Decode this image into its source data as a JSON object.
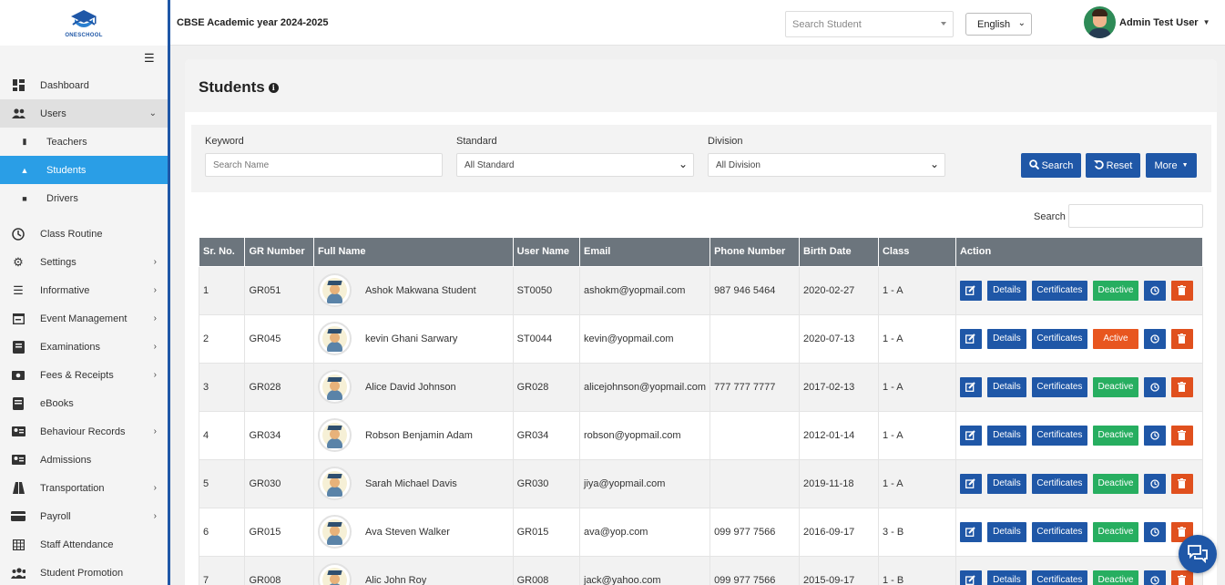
{
  "app": {
    "logo_text": "ONESCHOOL",
    "academic_year": "CBSE Academic year 2024-2025"
  },
  "topbar": {
    "search_placeholder": "Search Student",
    "language": "English",
    "user_name": "Admin Test User"
  },
  "sidebar": {
    "items": [
      {
        "label": "Dashboard",
        "icon": "dashboard-icon"
      },
      {
        "label": "Users",
        "icon": "users-icon"
      },
      {
        "label": "Teachers",
        "icon": "teacher-icon"
      },
      {
        "label": "Students",
        "icon": "graduation-cap-icon"
      },
      {
        "label": "Drivers",
        "icon": "bus-icon"
      },
      {
        "label": "Class Routine",
        "icon": "clock-icon"
      },
      {
        "label": "Settings",
        "icon": "gear-icon"
      },
      {
        "label": "Informative",
        "icon": "list-icon"
      },
      {
        "label": "Event Management",
        "icon": "calendar-icon"
      },
      {
        "label": "Examinations",
        "icon": "book-icon"
      },
      {
        "label": "Fees & Receipts",
        "icon": "money-icon"
      },
      {
        "label": "eBooks",
        "icon": "ebook-icon"
      },
      {
        "label": "Behaviour Records",
        "icon": "id-card-icon"
      },
      {
        "label": "Admissions",
        "icon": "address-card-icon"
      },
      {
        "label": "Transportation",
        "icon": "road-icon"
      },
      {
        "label": "Payroll",
        "icon": "credit-card-icon"
      },
      {
        "label": "Staff Attendance",
        "icon": "table-icon"
      },
      {
        "label": "Student Promotion",
        "icon": "group-icon"
      }
    ]
  },
  "page": {
    "title": "Students"
  },
  "filters": {
    "keyword_label": "Keyword",
    "keyword_placeholder": "Search Name",
    "standard_label": "Standard",
    "standard_value": "All Standard",
    "division_label": "Division",
    "division_value": "All Division",
    "search_btn": "Search",
    "reset_btn": "Reset",
    "more_btn": "More"
  },
  "table": {
    "search_label": "Search",
    "columns": [
      "Sr. No.",
      "GR Number",
      "Full Name",
      "User Name",
      "Email",
      "Phone Number",
      "Birth Date",
      "Class",
      "Action"
    ],
    "action_labels": {
      "details": "Details",
      "certificates": "Certificates"
    },
    "rows": [
      {
        "sr": "1",
        "gr": "GR051",
        "name": "Ashok Makwana Student",
        "user": "ST0050",
        "email": "ashokm@yopmail.com",
        "phone": "987 946 5464",
        "birth": "2020-02-27",
        "cls": "1 - A",
        "status": "Deactive"
      },
      {
        "sr": "2",
        "gr": "GR045",
        "name": "kevin Ghani Sarwary",
        "user": "ST0044",
        "email": "kevin@yopmail.com",
        "phone": "",
        "birth": "2020-07-13",
        "cls": "1 - A",
        "status": "Active"
      },
      {
        "sr": "3",
        "gr": "GR028",
        "name": "Alice David Johnson",
        "user": "GR028",
        "email": "alicejohnson@yopmail.com",
        "phone": "777 777 7777",
        "birth": "2017-02-13",
        "cls": "1 - A",
        "status": "Deactive"
      },
      {
        "sr": "4",
        "gr": "GR034",
        "name": "Robson Benjamin Adam",
        "user": "GR034",
        "email": "robson@yopmail.com",
        "phone": "",
        "birth": "2012-01-14",
        "cls": "1 - A",
        "status": "Deactive"
      },
      {
        "sr": "5",
        "gr": "GR030",
        "name": "Sarah Michael Davis",
        "user": "GR030",
        "email": "jiya@yopmail.com",
        "phone": "",
        "birth": "2019-11-18",
        "cls": "1 - A",
        "status": "Deactive"
      },
      {
        "sr": "6",
        "gr": "GR015",
        "name": "Ava Steven Walker",
        "user": "GR015",
        "email": "ava@yop.com",
        "phone": "099 977 7566",
        "birth": "2016-09-17",
        "cls": "3 - B",
        "status": "Deactive"
      },
      {
        "sr": "7",
        "gr": "GR008",
        "name": "Alic John Roy",
        "user": "GR008",
        "email": "jack@yahoo.com",
        "phone": "099 977 7566",
        "birth": "2015-09-17",
        "cls": "1 - B",
        "status": "Deactive"
      }
    ]
  },
  "colors": {
    "primary": "#1f57a7",
    "active_nav": "#2a9ee6",
    "success": "#27ae60",
    "danger": "#e0501e",
    "header": "#6c757d"
  }
}
